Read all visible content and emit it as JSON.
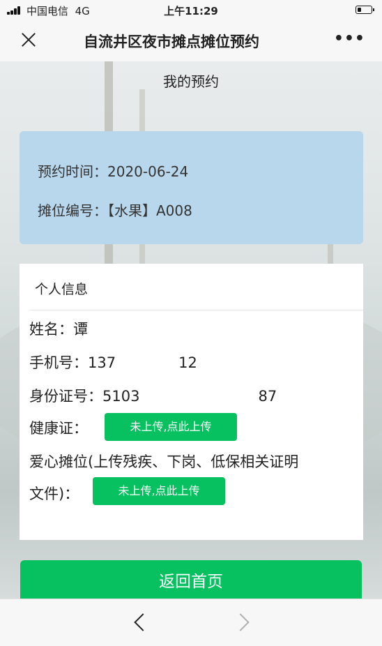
{
  "status_bar": {
    "carrier": "中国电信",
    "network": "4G",
    "time": "上午11:29"
  },
  "nav": {
    "title": "自流井区夜市摊点摊位预约"
  },
  "page": {
    "title": "我的预约"
  },
  "reservation": {
    "time_label": "预约时间：",
    "time_value": "2020-06-24",
    "stall_label": "摊位编号：",
    "stall_value": "【水果】A008"
  },
  "personal_info": {
    "heading": "个人信息",
    "name_label": "姓名：",
    "name_value": "谭",
    "phone_label": "手机号：",
    "phone_value_start": "137",
    "phone_value_end": "12",
    "id_label": "身份证号：",
    "id_value_start": "5103",
    "id_value_end": "87",
    "health_label": "健康证：",
    "health_button": "未上传,点此上传",
    "charity_label_line1": "爱心摊位(上传残疾、下岗、低保相关证明",
    "charity_label_line2": "文件)：",
    "charity_button": "未上传,点此上传"
  },
  "actions": {
    "back_home": "返回首页"
  },
  "colors": {
    "accent_green": "#07c160",
    "card_blue": "#b8d6ec"
  }
}
